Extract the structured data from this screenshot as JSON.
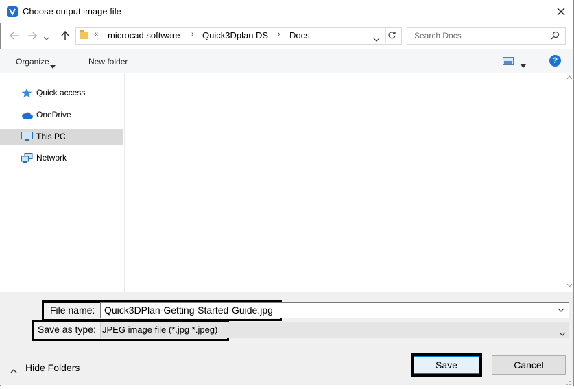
{
  "window": {
    "title": "Choose output image file"
  },
  "address_bar": {
    "overflow": "«",
    "crumbs": [
      "microcad software",
      "Quick3Dplan DS",
      "Docs"
    ],
    "separator": "›"
  },
  "search": {
    "placeholder": "Search Docs"
  },
  "toolbar": {
    "organize": "Organize",
    "new_folder": "New folder",
    "help": "?"
  },
  "nav_pane": {
    "items": [
      {
        "label": "Quick access",
        "icon": "star-icon"
      },
      {
        "label": "OneDrive",
        "icon": "cloud-icon"
      },
      {
        "label": "This PC",
        "icon": "monitor-icon",
        "selected": true
      },
      {
        "label": "Network",
        "icon": "network-icon"
      }
    ]
  },
  "form": {
    "file_name_label": "File name:",
    "file_name_value": "Quick3DPlan-Getting-Started-Guide.jpg",
    "save_type_label": "Save as type:",
    "save_type_value": "JPEG image file (*.jpg *.jpeg)"
  },
  "footer": {
    "hide_folders": "Hide Folders",
    "save": "Save",
    "cancel": "Cancel"
  },
  "colors": {
    "accent": "#1a73d0",
    "selection": "#d9d9d9",
    "bottom_bg": "#f0f0f0"
  }
}
